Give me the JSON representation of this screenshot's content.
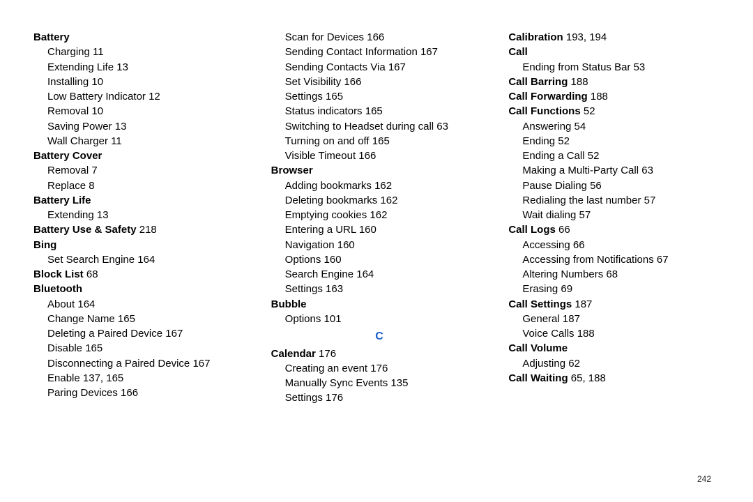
{
  "page_number": "242",
  "columns": [
    [
      {
        "t": "h",
        "text": "Battery"
      },
      {
        "t": "s",
        "text": "Charging",
        "pages": "11"
      },
      {
        "t": "s",
        "text": "Extending Life",
        "pages": "13"
      },
      {
        "t": "s",
        "text": "Installing",
        "pages": "10"
      },
      {
        "t": "s",
        "text": "Low Battery Indicator",
        "pages": "12"
      },
      {
        "t": "s",
        "text": "Removal",
        "pages": "10"
      },
      {
        "t": "s",
        "text": "Saving Power",
        "pages": "13"
      },
      {
        "t": "s",
        "text": "Wall Charger",
        "pages": "11"
      },
      {
        "t": "h",
        "text": "Battery Cover"
      },
      {
        "t": "s",
        "text": "Removal",
        "pages": "7"
      },
      {
        "t": "s",
        "text": "Replace",
        "pages": "8"
      },
      {
        "t": "h",
        "text": "Battery Life"
      },
      {
        "t": "s",
        "text": "Extending",
        "pages": "13"
      },
      {
        "t": "h",
        "text": "Battery Use & Safety",
        "pages": "218"
      },
      {
        "t": "h",
        "text": "Bing"
      },
      {
        "t": "s",
        "text": "Set Search Engine",
        "pages": "164"
      },
      {
        "t": "h",
        "text": "Block List",
        "pages": "68"
      },
      {
        "t": "h",
        "text": "Bluetooth"
      },
      {
        "t": "s",
        "text": "About",
        "pages": "164"
      },
      {
        "t": "s",
        "text": "Change Name",
        "pages": "165"
      },
      {
        "t": "s",
        "text": "Deleting a Paired Device",
        "pages": "167"
      },
      {
        "t": "s",
        "text": "Disable",
        "pages": "165"
      },
      {
        "t": "s",
        "text": "Disconnecting a Paired Device",
        "pages": "167"
      },
      {
        "t": "s",
        "text": "Enable",
        "pages": "137, 165"
      },
      {
        "t": "s",
        "text": "Paring Devices",
        "pages": "166"
      }
    ],
    [
      {
        "t": "s",
        "text": "Scan for Devices",
        "pages": "166"
      },
      {
        "t": "s",
        "text": "Sending Contact Information",
        "pages": "167"
      },
      {
        "t": "s",
        "text": "Sending Contacts Via",
        "pages": "167"
      },
      {
        "t": "s",
        "text": "Set Visibility",
        "pages": "166"
      },
      {
        "t": "s",
        "text": "Settings",
        "pages": "165"
      },
      {
        "t": "s",
        "text": "Status indicators",
        "pages": "165"
      },
      {
        "t": "s",
        "text": "Switching to Headset during call",
        "pages": "63"
      },
      {
        "t": "s",
        "text": "Turning on and off",
        "pages": "165"
      },
      {
        "t": "s",
        "text": "Visible Timeout",
        "pages": "166"
      },
      {
        "t": "h",
        "text": "Browser"
      },
      {
        "t": "s",
        "text": "Adding bookmarks",
        "pages": "162"
      },
      {
        "t": "s",
        "text": "Deleting bookmarks",
        "pages": "162"
      },
      {
        "t": "s",
        "text": "Emptying cookies",
        "pages": "162"
      },
      {
        "t": "s",
        "text": "Entering a URL",
        "pages": "160"
      },
      {
        "t": "s",
        "text": "Navigation",
        "pages": "160"
      },
      {
        "t": "s",
        "text": "Options",
        "pages": "160"
      },
      {
        "t": "s",
        "text": "Search Engine",
        "pages": "164"
      },
      {
        "t": "s",
        "text": "Settings",
        "pages": "163"
      },
      {
        "t": "h",
        "text": "Bubble"
      },
      {
        "t": "s",
        "text": "Options",
        "pages": "101"
      },
      {
        "t": "letter",
        "text": "C"
      },
      {
        "t": "h",
        "text": "Calendar",
        "pages": "176"
      },
      {
        "t": "s",
        "text": "Creating an event",
        "pages": "176"
      },
      {
        "t": "s",
        "text": "Manually Sync Events",
        "pages": "135"
      },
      {
        "t": "s",
        "text": "Settings",
        "pages": "176"
      }
    ],
    [
      {
        "t": "h",
        "text": "Calibration",
        "pages": "193, 194"
      },
      {
        "t": "h",
        "text": "Call"
      },
      {
        "t": "s",
        "text": "Ending from Status Bar",
        "pages": "53"
      },
      {
        "t": "h",
        "text": "Call Barring",
        "pages": "188"
      },
      {
        "t": "h",
        "text": "Call Forwarding",
        "pages": "188"
      },
      {
        "t": "h",
        "text": "Call Functions",
        "pages": "52"
      },
      {
        "t": "s",
        "text": "Answering",
        "pages": "54"
      },
      {
        "t": "s",
        "text": "Ending",
        "pages": "52"
      },
      {
        "t": "s",
        "text": "Ending a Call",
        "pages": "52"
      },
      {
        "t": "s",
        "text": "Making a Multi-Party Call",
        "pages": "63"
      },
      {
        "t": "s",
        "text": "Pause Dialing",
        "pages": "56"
      },
      {
        "t": "s",
        "text": "Redialing the last number",
        "pages": "57"
      },
      {
        "t": "s",
        "text": "Wait dialing",
        "pages": "57"
      },
      {
        "t": "h",
        "text": "Call Logs",
        "pages": "66"
      },
      {
        "t": "s",
        "text": "Accessing",
        "pages": "66"
      },
      {
        "t": "s",
        "text": "Accessing from Notifications",
        "pages": "67"
      },
      {
        "t": "s",
        "text": "Altering Numbers",
        "pages": "68"
      },
      {
        "t": "s",
        "text": "Erasing",
        "pages": "69"
      },
      {
        "t": "h",
        "text": "Call Settings",
        "pages": "187"
      },
      {
        "t": "s",
        "text": "General",
        "pages": "187"
      },
      {
        "t": "s",
        "text": "Voice Calls",
        "pages": "188"
      },
      {
        "t": "h",
        "text": "Call Volume"
      },
      {
        "t": "s",
        "text": "Adjusting",
        "pages": "62"
      },
      {
        "t": "h",
        "text": "Call Waiting",
        "pages": "65, 188"
      }
    ]
  ]
}
